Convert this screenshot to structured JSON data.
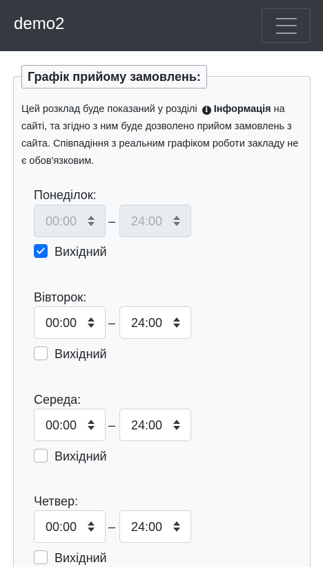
{
  "navbar": {
    "brand": "demo2",
    "menu_icon": "hamburger-menu-icon"
  },
  "schedule": {
    "title": "Графік прийому замовлень:",
    "description_before": "Цей розклад буде показаний у розділі",
    "info_icon": "info-circle-icon",
    "info_link": "Інформація",
    "description_after": "на сайті, та згідно з ним буде дозволено прийом замовлень з сайта. Співпадіння з реальним графіком роботи закладу не є обов'язковим.",
    "separator": "–",
    "days": [
      {
        "label": "Понеділок:",
        "from": "00:00",
        "to": "24:00",
        "day_off_label": "Вихідний",
        "day_off": true
      },
      {
        "label": "Вівторок:",
        "from": "00:00",
        "to": "24:00",
        "day_off_label": "Вихідний",
        "day_off": false
      },
      {
        "label": "Середа:",
        "from": "00:00",
        "to": "24:00",
        "day_off_label": "Вихідний",
        "day_off": false
      },
      {
        "label": "Четвер:",
        "from": "00:00",
        "to": "24:00",
        "day_off_label": "Вихідний",
        "day_off": false
      }
    ]
  },
  "colors": {
    "navbar_bg": "#343a40",
    "checkbox_checked": "#0d6efd",
    "disabled_input_bg": "#e9ecef"
  }
}
